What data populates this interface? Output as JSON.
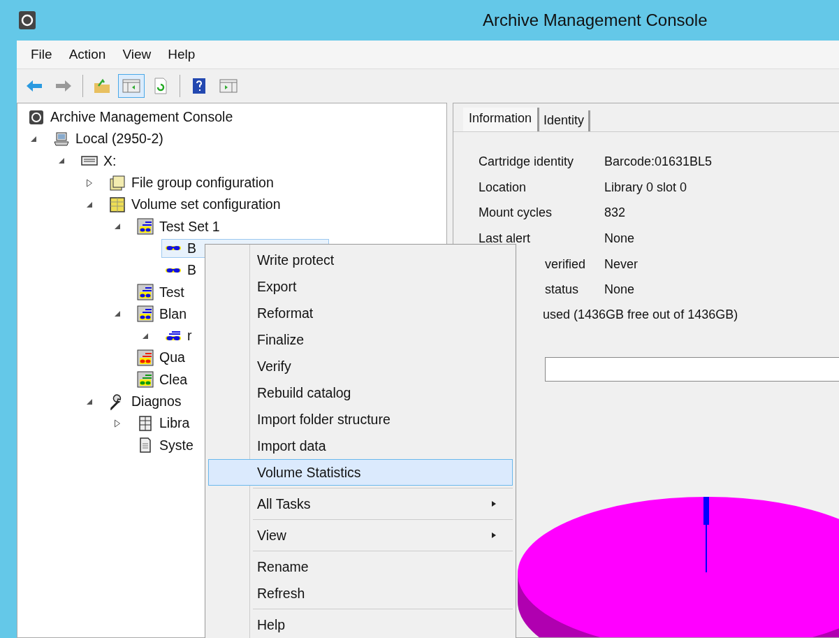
{
  "window": {
    "title": "Archive Management Console"
  },
  "menu_bar": [
    "File",
    "Action",
    "View",
    "Help"
  ],
  "toolbar": [
    [
      {
        "kind": "back",
        "pressed": false
      },
      {
        "kind": "forward",
        "pressed": false
      }
    ],
    [
      {
        "kind": "up-folder",
        "pressed": false
      },
      {
        "kind": "tree-toggle",
        "pressed": true
      },
      {
        "kind": "refresh",
        "pressed": false
      }
    ],
    [
      {
        "kind": "help",
        "pressed": false
      },
      {
        "kind": "action-pane",
        "pressed": false
      }
    ]
  ],
  "tree": [
    {
      "label": "Archive Management Console",
      "kind": "root",
      "selected": false,
      "children": [
        {
          "label": "Local (2950-2)",
          "kind": "computer",
          "expanded": true,
          "selected": false,
          "children": [
            {
              "label": "X:",
              "kind": "drive",
              "expanded": true,
              "selected": false,
              "children": [
                {
                  "label": "File group configuration",
                  "kind": "file-groups",
                  "expanded": false,
                  "selected": false
                },
                {
                  "label": "Volume set configuration",
                  "kind": "volume-sets",
                  "expanded": true,
                  "selected": false,
                  "children": [
                    {
                      "label": "Test Set 1",
                      "kind": "set",
                      "color": "#1010e0",
                      "expanded": true,
                      "selected": false,
                      "children": [
                        {
                          "label": "B",
                          "kind": "volume",
                          "selected": true
                        },
                        {
                          "label": "B",
                          "kind": "volume",
                          "selected": false
                        }
                      ]
                    },
                    {
                      "label": "Test",
                      "kind": "set",
                      "color": "#1010e0",
                      "selected": false
                    },
                    {
                      "label": "Blan",
                      "kind": "set",
                      "color": "#1010e0",
                      "expanded": true,
                      "selected": false,
                      "children": [
                        {
                          "label": "r",
                          "kind": "volume-group",
                          "expanded": true,
                          "selected": false
                        }
                      ]
                    },
                    {
                      "label": "Qua",
                      "kind": "set",
                      "color": "#ee2200",
                      "selected": false
                    },
                    {
                      "label": "Clea",
                      "kind": "set",
                      "color": "#119911",
                      "selected": false
                    }
                  ]
                },
                {
                  "label": "Diagnos",
                  "kind": "diagnostics",
                  "expanded": true,
                  "selected": false,
                  "children": [
                    {
                      "label": "Libra",
                      "kind": "library",
                      "expanded": false,
                      "selected": false
                    },
                    {
                      "label": "Syste",
                      "kind": "system",
                      "selected": false
                    }
                  ]
                }
              ]
            }
          ]
        }
      ]
    }
  ],
  "tabs": [
    {
      "label": "Information",
      "selected": true
    },
    {
      "label": "Identity",
      "selected": false
    }
  ],
  "info": [
    {
      "label": "Cartridge identity",
      "value": "Barcode:01631BL5",
      "covered": false
    },
    {
      "label": "Location",
      "value": "Library 0 slot 0",
      "covered": false
    },
    {
      "label": "Mount cycles",
      "value": "832",
      "covered": false
    },
    {
      "label": "Last alert",
      "value": "None",
      "covered": false
    },
    {
      "label": "verified",
      "value": "Never",
      "covered": true
    },
    {
      "label": "status",
      "value": "None",
      "covered": true
    }
  ],
  "usage": {
    "text": "used (1436GB free out of 1436GB)",
    "level": 0
  },
  "context_menu": [
    [
      {
        "label": "Write protect",
        "selected": false
      },
      {
        "label": "Export",
        "selected": false
      },
      {
        "label": "Reformat",
        "selected": false
      },
      {
        "label": "Finalize",
        "selected": false
      },
      {
        "label": "Verify",
        "selected": false
      },
      {
        "label": "Rebuild catalog",
        "selected": false
      },
      {
        "label": "Import folder structure",
        "selected": false
      },
      {
        "label": "Import data",
        "selected": false
      },
      {
        "label": "Volume Statistics",
        "selected": true
      }
    ],
    [
      {
        "label": "All Tasks",
        "selected": false,
        "submenu": true
      }
    ],
    [
      {
        "label": "View",
        "selected": false,
        "submenu": true
      }
    ],
    [
      {
        "label": "Rename",
        "selected": false
      },
      {
        "label": "Refresh",
        "selected": false
      }
    ],
    [
      {
        "label": "Help",
        "selected": false
      }
    ]
  ]
}
